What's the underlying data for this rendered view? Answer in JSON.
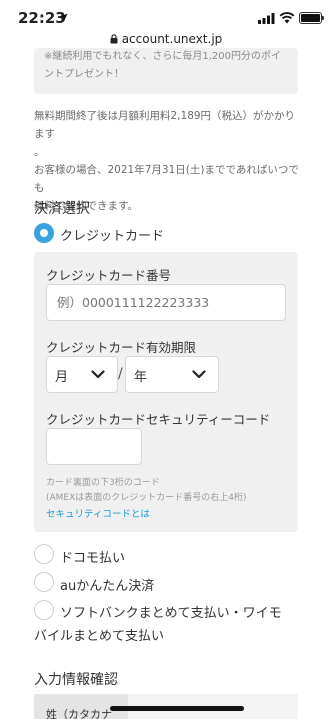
{
  "status_bar": {
    "time": "22:23"
  },
  "url_bar": {
    "domain": "account.unext.jp"
  },
  "promo": {
    "line1": "※継続利用でもれなく、さらに毎月1,200円分のポイ",
    "line2": "ントプレゼント！"
  },
  "notice": {
    "line1": "無料期間終了後は月額利用料2,189円（税込）がかかります",
    "line2": "。",
    "line3": "お客様の場合、2021年7月31日(土)までであればいつでも",
    "line4": "無料で解約できます。"
  },
  "payment": {
    "title": "決済選択",
    "options": [
      {
        "label": "クレジットカード",
        "selected": true
      },
      {
        "label": "ドコモ払い",
        "selected": false
      },
      {
        "label": "auかんたん決済",
        "selected": false
      },
      {
        "label_line1": "ソフトバンクまとめて支払い・ワイモ",
        "label_line2": "バイルまとめて支払い",
        "selected": false
      }
    ]
  },
  "card_form": {
    "number_label": "クレジットカード番号",
    "number_placeholder": "例）0000111122223333",
    "expiry_label": "クレジットカード有効期限",
    "month_value": "月",
    "slash": "/",
    "year_value": "年",
    "cvc_label": "クレジットカードセキュリティーコード",
    "cvc_help1": "カード裏面の下3桁のコード",
    "cvc_help2": "(AMEXは表面のクレジットカード番号の右上4桁)",
    "cvc_link": "セキュリティコードとは"
  },
  "confirm": {
    "title": "入力情報確認",
    "first_row_label": "姓（カタカナ"
  },
  "colors": {
    "accent": "#3aa3dd",
    "link": "#1a9bd7",
    "panel": "#f0f0f0"
  }
}
